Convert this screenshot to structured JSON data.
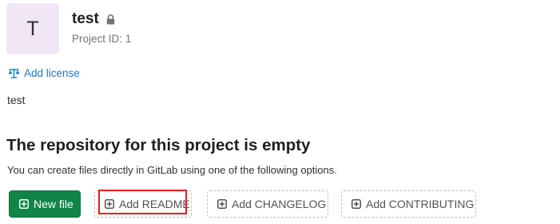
{
  "project": {
    "avatar_letter": "T",
    "name": "test",
    "id_text": "Project ID: 1",
    "description": "test"
  },
  "links": {
    "add_license": "Add license"
  },
  "empty_state": {
    "title": "The repository for this project is empty",
    "description": "You can create files directly in GitLab using one of the following options."
  },
  "actions": {
    "new_file": "New file",
    "add_readme": "Add README",
    "add_changelog": "Add CHANGELOG",
    "add_contributing": "Add CONTRIBUTING"
  },
  "colors": {
    "avatar_bg": "#f0e6f6",
    "link": "#1f75cb",
    "primary_button": "#108548",
    "highlight": "#e02020"
  },
  "icons": {
    "visibility": "lock-icon",
    "license": "scale-icon",
    "button": "plus-square-icon"
  }
}
